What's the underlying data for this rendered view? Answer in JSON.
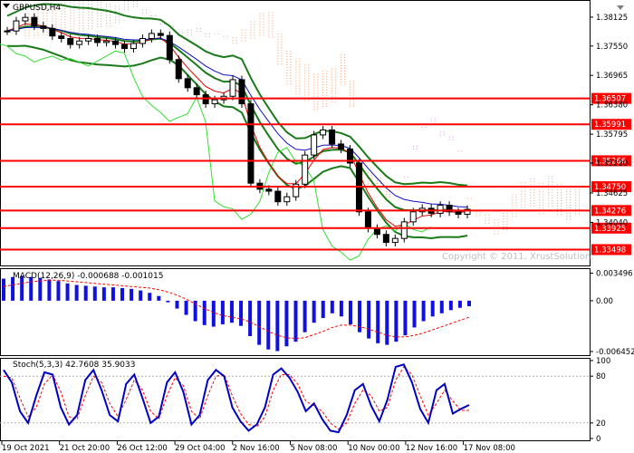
{
  "window": {
    "symbol_label": "GBPUSD,H4",
    "copyright": "Copyright © 2011, XrustSolution."
  },
  "colors": {
    "candles": "#000000",
    "bollinger": "#1a7a1a",
    "ema_fast": "#e00000",
    "ema_slow": "#1010c0",
    "chikou": "#33dd33",
    "kumo_up": "#f0a070",
    "kumo_down": "#d090d0",
    "level_line": "#ff0000",
    "level_label_bg": "#ff0000",
    "macd_hist": "#1010e0",
    "macd_signal": "#ff0000",
    "stoch_main": "#0000c0",
    "stoch_signal": "#ff0000"
  },
  "chart_data": [
    {
      "type": "line",
      "panel": "price",
      "title": "GBPUSD,H4",
      "y_ticks": [
        "1.38125",
        "1.37550",
        "1.36965",
        "1.36380",
        "1.35795",
        "1.35220",
        "1.34625",
        "1.34040"
      ],
      "ylim": [
        1.332,
        1.3843
      ],
      "horizontal_levels": [
        "1.36507",
        "1.35991",
        "1.35266",
        "1.34750",
        "1.34276",
        "1.33925",
        "1.33498"
      ],
      "x_tick_labels": [
        "19 Oct 2021",
        "21 Oct 20:00",
        "26 Oct 12:00",
        "29 Oct 04:00",
        "2 Nov 16:00",
        "5 Nov 08:00",
        "10 Nov 00:00",
        "12 Nov 16:00",
        "17 Nov 08:00"
      ],
      "close": [
        1.3785,
        1.3805,
        1.3812,
        1.3795,
        1.379,
        1.3775,
        1.377,
        1.3758,
        1.3765,
        1.377,
        1.3762,
        1.3765,
        1.3758,
        1.375,
        1.376,
        1.377,
        1.378,
        1.3776,
        1.3728,
        1.369,
        1.3672,
        1.3658,
        1.364,
        1.3648,
        1.3655,
        1.3688,
        1.364,
        1.3482,
        1.347,
        1.3466,
        1.3445,
        1.3455,
        1.348,
        1.3538,
        1.3578,
        1.3588,
        1.356,
        1.355,
        1.3522,
        1.3425,
        1.3392,
        1.338,
        1.3364,
        1.3372,
        1.3405,
        1.3425,
        1.3432,
        1.3422,
        1.3438,
        1.3425,
        1.342,
        1.343
      ]
    },
    {
      "type": "bar",
      "panel": "macd",
      "title": "MACD(12,26,9) -0.000688 -0.001015",
      "y_ticks": [
        "0.003496",
        "0.00",
        "-0.006452"
      ],
      "ylim": [
        -0.0068,
        0.0039
      ],
      "values": [
        0.0028,
        0.003,
        0.0031,
        0.003,
        0.0029,
        0.0027,
        0.0025,
        0.0022,
        0.002,
        0.0019,
        0.0018,
        0.0017,
        0.0017,
        0.0016,
        0.0015,
        0.0013,
        0.001,
        0.0006,
        -0.0002,
        -0.001,
        -0.0018,
        -0.0026,
        -0.0031,
        -0.0033,
        -0.003,
        -0.0028,
        -0.0032,
        -0.0045,
        -0.0056,
        -0.0062,
        -0.0064,
        -0.0058,
        -0.0052,
        -0.004,
        -0.0028,
        -0.0022,
        -0.0016,
        -0.002,
        -0.003,
        -0.004,
        -0.0048,
        -0.0054,
        -0.0056,
        -0.0052,
        -0.0044,
        -0.0034,
        -0.0026,
        -0.002,
        -0.0016,
        -0.0012,
        -0.0009,
        -0.0007
      ],
      "signal": [
        0.0018,
        0.002,
        0.0022,
        0.0024,
        0.0025,
        0.0026,
        0.0026,
        0.0025,
        0.0024,
        0.0023,
        0.0022,
        0.0021,
        0.002,
        0.0019,
        0.0018,
        0.0017,
        0.0016,
        0.0014,
        0.0011,
        0.0007,
        0.0002,
        -0.0004,
        -0.001,
        -0.0015,
        -0.0019,
        -0.0021,
        -0.0023,
        -0.0027,
        -0.0033,
        -0.0039,
        -0.0044,
        -0.0047,
        -0.0048,
        -0.0047,
        -0.0043,
        -0.0039,
        -0.0034,
        -0.0031,
        -0.0031,
        -0.0033,
        -0.0036,
        -0.004,
        -0.0044,
        -0.0046,
        -0.0046,
        -0.0044,
        -0.0041,
        -0.0037,
        -0.0033,
        -0.0029,
        -0.0025,
        -0.0021
      ]
    },
    {
      "type": "line",
      "panel": "stochastic",
      "title": "Stoch(5,3,3) 42.7608 35.9033",
      "y_ticks": [
        "100",
        "80",
        "20",
        "0"
      ],
      "ylim": [
        0,
        100
      ],
      "series": [
        {
          "name": "main",
          "values": [
            88,
            72,
            35,
            20,
            55,
            85,
            82,
            40,
            18,
            30,
            75,
            88,
            62,
            30,
            22,
            70,
            82,
            52,
            20,
            28,
            72,
            85,
            60,
            18,
            30,
            75,
            88,
            80,
            40,
            22,
            10,
            18,
            40,
            82,
            90,
            78,
            60,
            35,
            45,
            25,
            10,
            8,
            30,
            62,
            70,
            42,
            22,
            50,
            92,
            95,
            72,
            38,
            20,
            62,
            70,
            32,
            38,
            43
          ]
        },
        {
          "name": "signal",
          "values": [
            80,
            78,
            52,
            28,
            40,
            70,
            82,
            60,
            28,
            25,
            55,
            80,
            72,
            45,
            28,
            50,
            75,
            62,
            35,
            25,
            55,
            78,
            68,
            35,
            25,
            55,
            80,
            82,
            55,
            32,
            18,
            15,
            28,
            62,
            82,
            82,
            70,
            48,
            42,
            35,
            20,
            12,
            20,
            45,
            62,
            55,
            35,
            40,
            75,
            92,
            82,
            55,
            30,
            45,
            62,
            48,
            36,
            36
          ]
        }
      ]
    }
  ]
}
